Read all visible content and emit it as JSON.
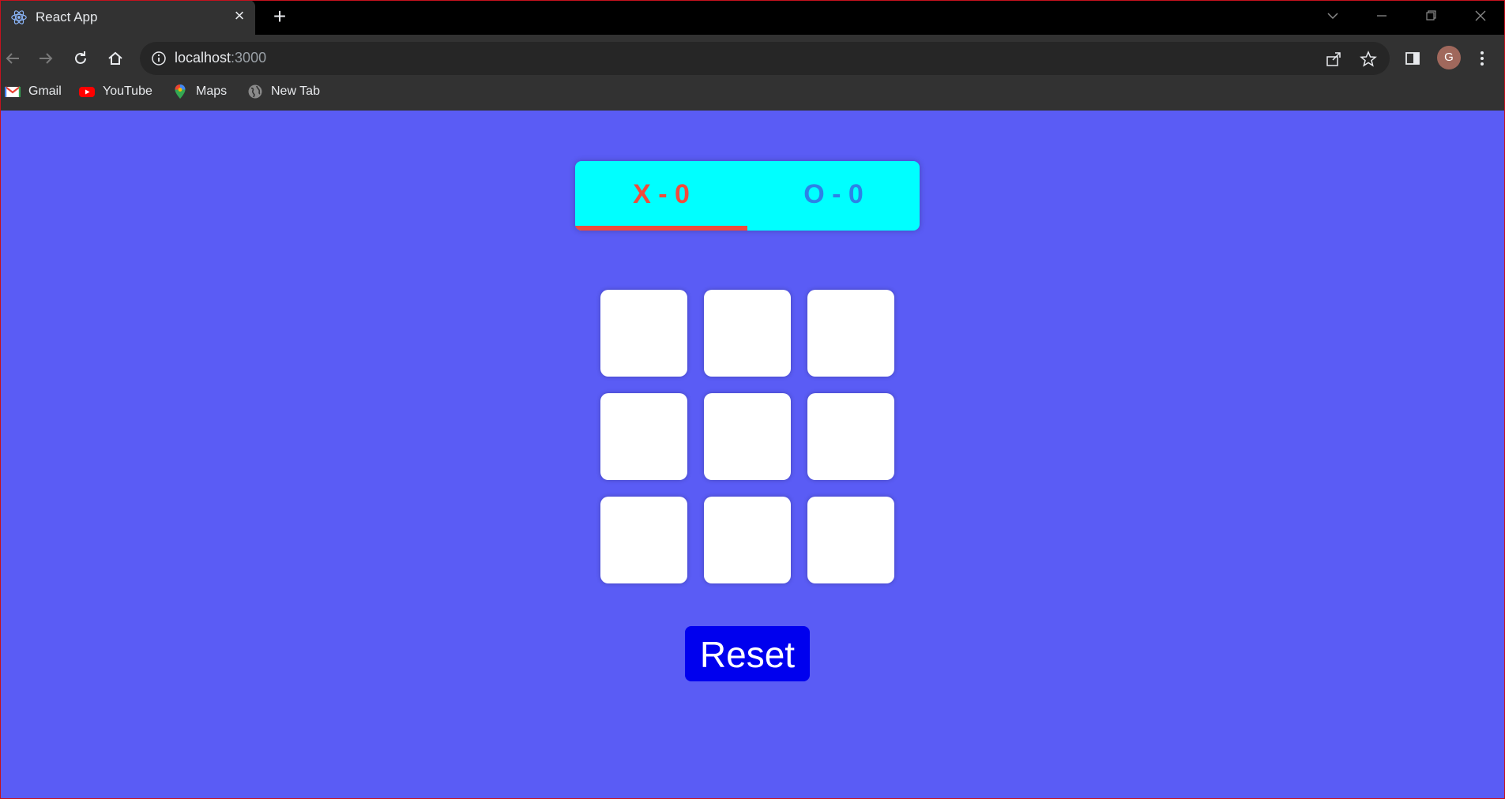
{
  "browser": {
    "tab": {
      "title": "React App",
      "icon": "react-logo-icon"
    },
    "address": {
      "host": "localhost",
      "port": ":3000"
    },
    "bookmarks": [
      {
        "label": "Gmail",
        "icon": "gmail-icon"
      },
      {
        "label": "YouTube",
        "icon": "youtube-icon"
      },
      {
        "label": "Maps",
        "icon": "maps-icon"
      },
      {
        "label": "New Tab",
        "icon": "globe-icon"
      }
    ],
    "profile_initial": "G"
  },
  "game": {
    "score_x": "X - 0",
    "score_o": "O - 0",
    "current_turn": "X",
    "board": [
      "",
      "",
      "",
      "",
      "",
      "",
      "",
      "",
      ""
    ],
    "reset_label": "Reset"
  },
  "colors": {
    "page_background": "#5a5cf5",
    "scoreboard": "#00ffff",
    "x_color": "#ef4b3c",
    "o_color": "#2d82e6",
    "reset_button": "#0000ee"
  }
}
